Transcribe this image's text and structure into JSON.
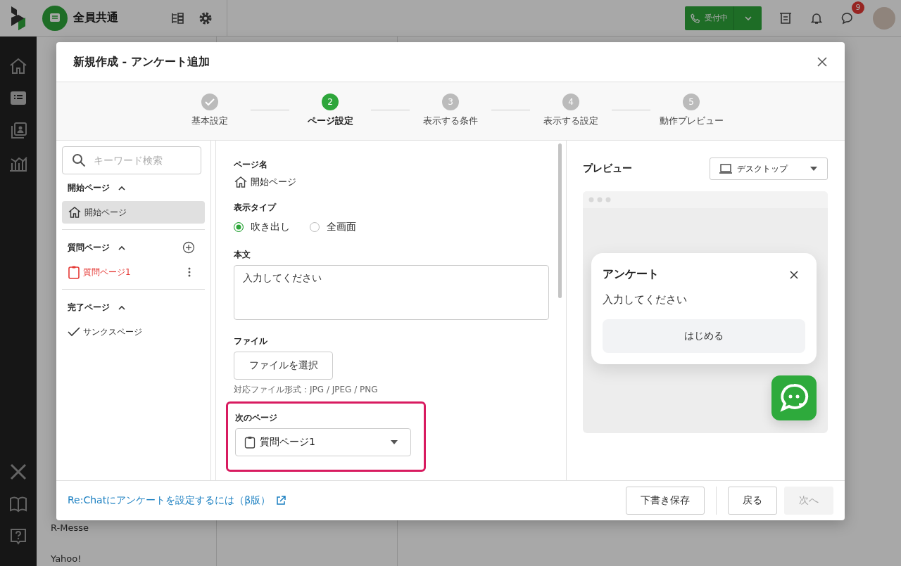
{
  "top_bar": {
    "workspace": "全員共通",
    "status_button": "受付中",
    "chat_badge": "9"
  },
  "background_list": [
    {
      "label": "R-Messe"
    },
    {
      "label": "Yahoo!"
    }
  ],
  "modal": {
    "title": "新規作成 - アンケート追加",
    "steps": [
      {
        "label": "基本設定",
        "done": true,
        "selected": false
      },
      {
        "number": "2",
        "label": "ページ設定",
        "done": false,
        "selected": true
      },
      {
        "number": "3",
        "label": "表示する条件",
        "done": false,
        "selected": false
      },
      {
        "number": "4",
        "label": "表示する設定",
        "done": false,
        "selected": false
      },
      {
        "number": "5",
        "label": "動作プレビュー",
        "done": false,
        "selected": false
      }
    ],
    "search": {
      "placeholder": "キーワード検索"
    },
    "sections": [
      {
        "title": "開始ページ",
        "kind": "start",
        "expanded": true,
        "items": [
          {
            "label": "開始ページ",
            "kind": "home",
            "selected": true,
            "error": false,
            "has_menu": false
          }
        ]
      },
      {
        "title": "質問ページ",
        "kind": "question",
        "expanded": true,
        "items": [
          {
            "label": "質問ページ1",
            "kind": "question",
            "selected": false,
            "error": true,
            "has_menu": true
          }
        ]
      },
      {
        "title": "完了ページ",
        "kind": "complete",
        "expanded": true,
        "items": [
          {
            "label": "サンクスページ",
            "kind": "complete",
            "selected": false,
            "error": false,
            "has_menu": false
          }
        ]
      }
    ],
    "form": {
      "page_name_label": "ページ名",
      "page_name": "開始ページ",
      "display_type_label": "表示タイプ",
      "display_types": [
        {
          "label": "吹き出し",
          "selected": true
        },
        {
          "label": "全画面",
          "selected": false
        }
      ],
      "body_label": "本文",
      "body_value": "入力してください",
      "file_label": "ファイル",
      "file_button": "ファイルを選択",
      "file_hint": "対応ファイル形式：JPG / JPEG / PNG",
      "next_page_label": "次のページ",
      "next_page_value": "質問ページ1",
      "next_page_highlighted": true
    }
  },
  "preview": {
    "title": "プレビュー",
    "device": "デスクトップ",
    "popup_title": "アンケート",
    "popup_text": "入力してください",
    "popup_button": "はじめる"
  },
  "footer": {
    "help_link": "Re:Chatにアンケートを設定するには（β版）",
    "buttons": [
      {
        "label": "下書き保存",
        "disabled": false
      },
      {
        "label": "戻る",
        "disabled": false
      },
      {
        "label": "次へ",
        "disabled": true
      }
    ]
  }
}
